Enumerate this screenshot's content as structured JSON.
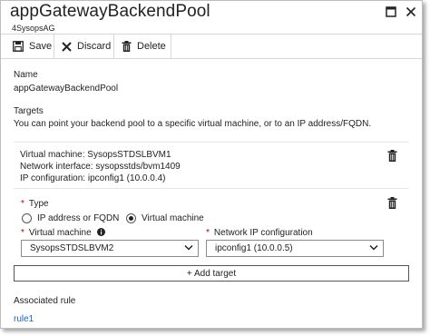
{
  "window": {
    "title": "appGatewayBackendPool",
    "subtitle": "4SysopsAG"
  },
  "toolbar": {
    "save_label": "Save",
    "discard_label": "Discard",
    "delete_label": "Delete"
  },
  "name_section": {
    "label": "Name",
    "value": "appGatewayBackendPool"
  },
  "targets_section": {
    "label": "Targets",
    "description": "You can point your backend pool to a specific virtual machine, or to an IP address/FQDN."
  },
  "existing_target": {
    "virtual_machine": "Virtual machine: SysopsSTDSLBVM1",
    "network_interface": "Network interface: sysopsstds/bvm1409",
    "ip_configuration": "IP configuration: ipconfig1 (10.0.0.4)"
  },
  "new_target": {
    "type_label": "Type",
    "options": [
      "IP address or FQDN",
      "Virtual machine"
    ],
    "selected_option": "Virtual machine",
    "vm_label": "Virtual machine",
    "vm_value": "SysopsSTDSLBVM2",
    "nic_ip_label": "Network IP configuration",
    "nic_ip_value": "ipconfig1 (10.0.0.5)",
    "required_marker": "*"
  },
  "add_target_label": "+ Add target",
  "associated_rule": {
    "label": "Associated rule",
    "link": "rule1"
  },
  "colors": {
    "link": "#1565c0",
    "required": "#c00000",
    "border": "#d6d6d6"
  },
  "icons": {
    "maximize": "maximize-icon",
    "close": "close-icon",
    "save": "save-icon",
    "discard": "discard-x-icon",
    "delete": "trash-icon",
    "info": "info-icon",
    "dropdown": "chevron-down-icon"
  }
}
